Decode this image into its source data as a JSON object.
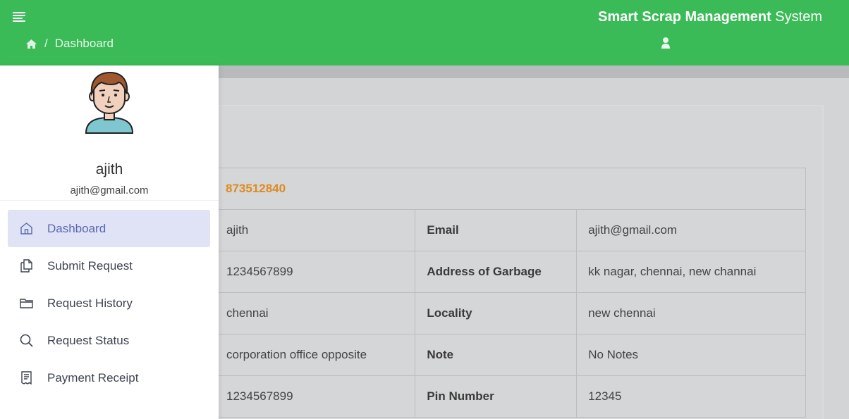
{
  "header": {
    "brand_bold": "Smart Scrap Management",
    "brand_rest": " System",
    "breadcrumb_separator": "/",
    "breadcrumb_current": "Dashboard",
    "accent_color": "#3abb57"
  },
  "sidebar": {
    "user_name": "ajith",
    "user_email": "ajith@gmail.com",
    "items": [
      {
        "label": "Dashboard",
        "icon": "home-icon",
        "active": true
      },
      {
        "label": "Submit Request",
        "icon": "documents-icon",
        "active": false
      },
      {
        "label": "Request History",
        "icon": "folder-icon",
        "active": false
      },
      {
        "label": "Request Status",
        "icon": "search-icon",
        "active": false
      },
      {
        "label": "Payment Receipt",
        "icon": "receipt-icon",
        "active": false
      }
    ]
  },
  "details": {
    "request_id": "873512840",
    "rows": [
      {
        "value1": "ajith",
        "label": "Email",
        "value2": "ajith@gmail.com"
      },
      {
        "value1": "1234567899",
        "label": "Address of Garbage",
        "value2": "kk nagar, chennai, new channai"
      },
      {
        "value1": "chennai",
        "label": "Locality",
        "value2": "new chennai"
      },
      {
        "value1": "corporation office opposite",
        "label": "Note",
        "value2": "No Notes"
      },
      {
        "value1": "1234567899",
        "label": "Pin Number",
        "value2": "12345"
      }
    ]
  }
}
